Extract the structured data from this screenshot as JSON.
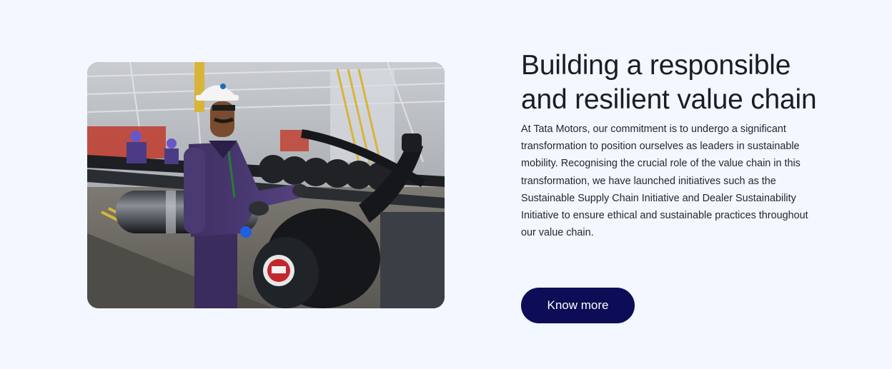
{
  "section": {
    "title": "Building a responsible and resilient value chain",
    "description": "At Tata Motors, our commitment is to undergo a significant transformation to position ourselves as leaders in sustainable mobility. Recognising the crucial role of the value chain in this transformation, we have launched initiatives such as the Sustainable Supply Chain Initiative and Dealer Sustainability Initiative to ensure ethical and sustainable practices throughout our value chain.",
    "cta_label": "Know more"
  },
  "image": {
    "alt": "Worker in hard hat standing beside truck chassis on assembly line"
  },
  "colors": {
    "page_background": "#f3f7ff",
    "button_background": "#0c0c57",
    "button_text": "#ffffff",
    "title_text": "#1b1d22"
  }
}
